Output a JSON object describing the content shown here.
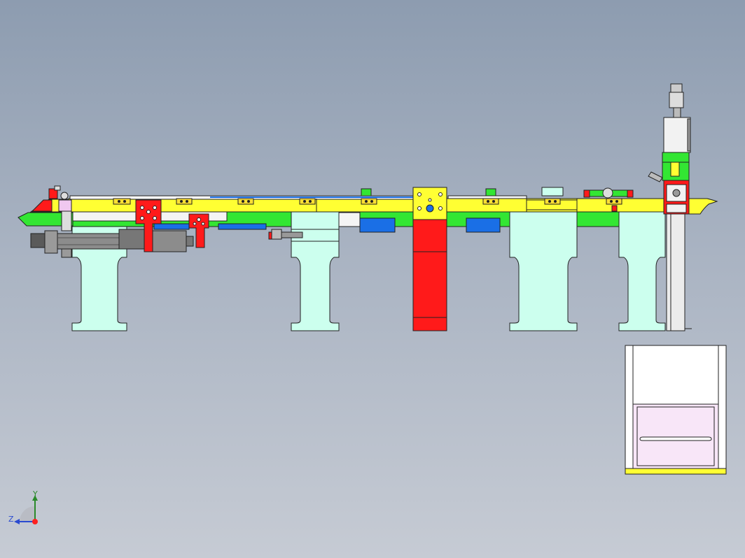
{
  "viewport": {
    "background_top": "#8d9cb0",
    "background_bottom": "#c6cbd4"
  },
  "colors": {
    "rail_yellow": "#ffff33",
    "rail_green": "#33e633",
    "support_cyan": "#ccffee",
    "actuator_red": "#ff1a1a",
    "cylinder_grey": "#8c8c8c",
    "sensor_blue": "#1a6fe6",
    "panel_pink": "#f8e6f8",
    "outline": "#222222"
  },
  "triad": {
    "y_label": "Y",
    "z_label": "Z",
    "icon": "coordinate-triad-icon"
  }
}
